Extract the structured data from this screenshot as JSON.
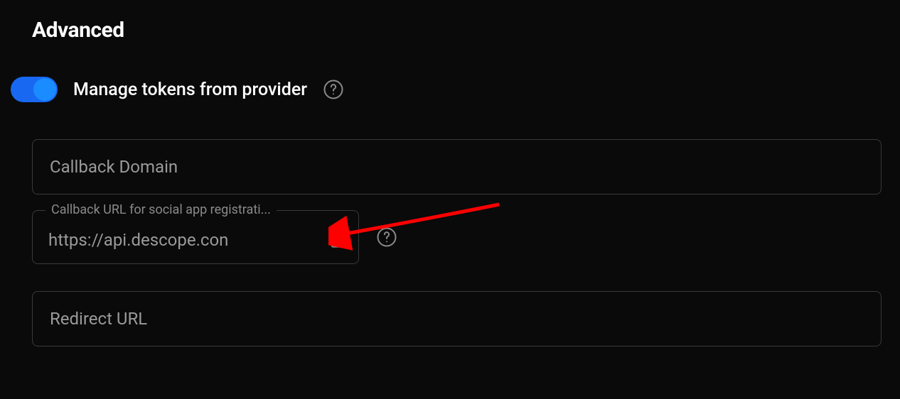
{
  "section": {
    "title": "Advanced"
  },
  "toggle": {
    "label": "Manage tokens from provider",
    "enabled": true
  },
  "fields": {
    "callbackDomain": {
      "placeholder": "Callback Domain"
    },
    "callbackUrl": {
      "legend": "Callback URL for social app registrati...",
      "value": "https://api.descope.con"
    },
    "redirectUrl": {
      "placeholder": "Redirect URL"
    }
  }
}
